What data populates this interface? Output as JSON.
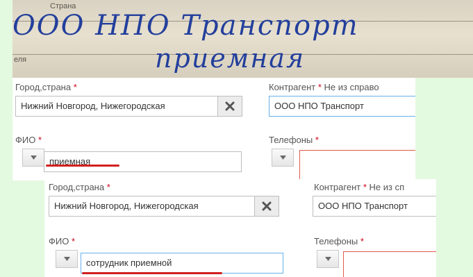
{
  "photo": {
    "printed_label_country": "Страна",
    "printed_label_partial": "еля",
    "handwritten_line1": "ООО НПО Транспорт",
    "handwritten_line2": "приемная"
  },
  "form_before": {
    "city_label": "Город,страна",
    "required_mark": "*",
    "city_value": "Нижний Новгород, Нижегородская",
    "contractor_label": "Контрагент",
    "contractor_note": "Не из справо",
    "contractor_value": "ООО НПО Транспорт",
    "fio_label": "ФИО",
    "fio_value": "приемная",
    "phones_label": "Телефоны"
  },
  "form_after": {
    "city_label": "Город,страна",
    "required_mark": "*",
    "city_value": "Нижний Новгород, Нижегородская",
    "contractor_label": "Контрагент",
    "contractor_note": "Не из сп",
    "contractor_value": "ООО НПО Транспорт",
    "fio_label": "ФИО",
    "fio_value": "сотрудник приемной",
    "phones_label": "Телефоны"
  },
  "colors": {
    "background": "#e3f9e0",
    "required": "#d0021b",
    "handwriting": "#233f9c",
    "underline": "#d21f1f",
    "focus_border": "#66afe9"
  }
}
